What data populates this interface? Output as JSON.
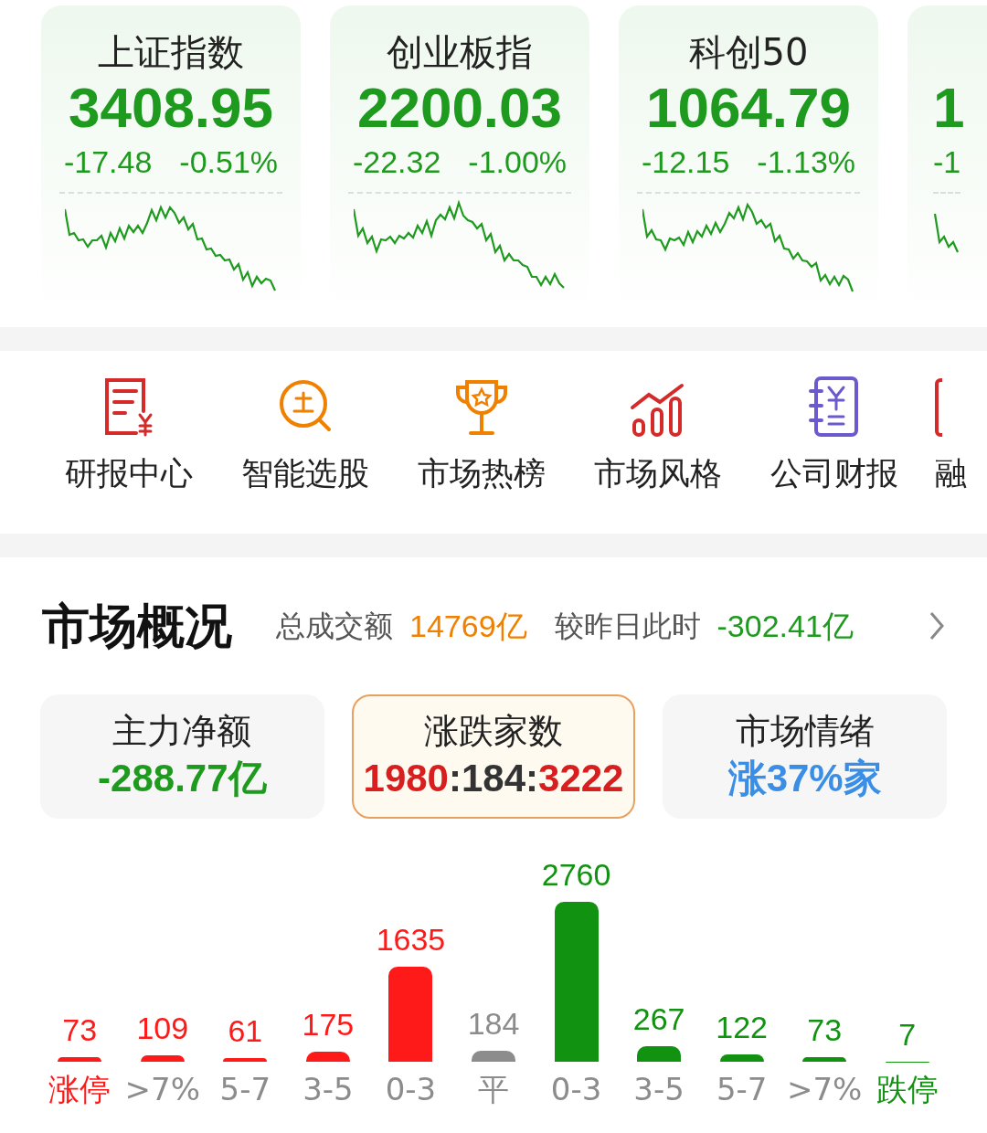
{
  "indices": [
    {
      "name": "上证指数",
      "value": "3408.95",
      "change": "-17.48",
      "percent": "-0.51%"
    },
    {
      "name": "创业板指",
      "value": "2200.03",
      "change": "-22.32",
      "percent": "-1.00%"
    },
    {
      "name": "科创50",
      "value": "1064.79",
      "change": "-12.15",
      "percent": "-1.13%"
    },
    {
      "value": "1",
      "change": "-1"
    }
  ],
  "tools": [
    {
      "label": "研报中心",
      "kind": "report",
      "color": "#d42a2a"
    },
    {
      "label": "智能选股",
      "kind": "pick",
      "color": "#f08000"
    },
    {
      "label": "市场热榜",
      "kind": "trophy",
      "color": "#f08000"
    },
    {
      "label": "市场风格",
      "kind": "chart",
      "color": "#d42a2a"
    },
    {
      "label": "公司财报",
      "kind": "book",
      "color": "#6a5acd"
    },
    {
      "label": "融",
      "kind": "cut",
      "color": "#d42a2a"
    }
  ],
  "overview": {
    "title": "市场概况",
    "turnover_label": "总成交额",
    "turnover": "14769亿",
    "compare_label": "较昨日此时",
    "compare": "-302.41亿"
  },
  "stat_cards": [
    {
      "title": "主力净额",
      "selected": false,
      "parts": [
        {
          "text": "-288.77亿",
          "color": "#1e9a1e"
        }
      ]
    },
    {
      "title": "涨跌家数",
      "selected": true,
      "parts": [
        {
          "text": "1980",
          "color": "#d81e1e"
        },
        {
          "text": ":",
          "color": "#333333"
        },
        {
          "text": "184",
          "color": "#333333"
        },
        {
          "text": ":",
          "color": "#333333"
        },
        {
          "text": "3222",
          "color": "#d81e1e"
        }
      ]
    },
    {
      "title": "市场情绪",
      "selected": false,
      "parts": [
        {
          "text": "涨37%家",
          "color": "#3a8ee6"
        }
      ]
    }
  ],
  "distribution": {
    "chart_data": {
      "type": "bar",
      "categories": [
        "涨停",
        ">7%",
        "5-7",
        "3-5",
        "0-3",
        "平",
        "0-3",
        "3-5",
        "5-7",
        ">7%",
        "跌停"
      ],
      "data_labels": true,
      "series": [
        {
          "color": "#ff1a1a",
          "values": [
            73,
            109,
            61,
            175,
            1635,
            null,
            null,
            null,
            null,
            null,
            null
          ]
        },
        {
          "color": "#8c8c8c",
          "values": [
            null,
            null,
            null,
            null,
            null,
            184,
            null,
            null,
            null,
            null,
            null
          ]
        },
        {
          "color": "#119211",
          "values": [
            null,
            null,
            null,
            null,
            null,
            null,
            2760,
            267,
            122,
            73,
            7
          ]
        }
      ]
    }
  }
}
